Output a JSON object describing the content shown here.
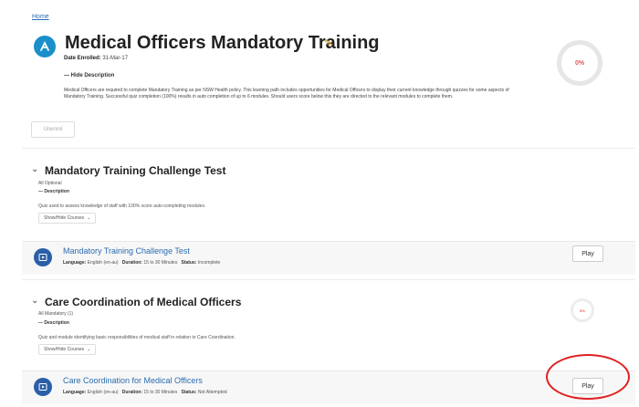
{
  "breadcrumb": {
    "home": "Home"
  },
  "header": {
    "title": "Medical Officers Mandatory Training",
    "date_enrolled_label": "Date Enrolled:",
    "date_enrolled_value": "31-Mar-17",
    "hide_description": "— Hide Description",
    "description": "Medical Officers are required to complete Mandatory Training as per NSW Health policy. This learning path includes opportunities for Medical Officers to display their current knowledge through quizzes for some aspects of Mandatory Training. Successful quiz completion (100%) results in auto completion of up to 6 modules. Should users score below this they are directed to the relevant modules to complete them.",
    "progress": "0%",
    "unenrol_label": "Unenrol"
  },
  "sections": [
    {
      "title": "Mandatory Training Challenge Test",
      "optional_label": "All Optional",
      "description_label": "— Description",
      "description": "Quiz used to assess knowledge of staff with 100% score auto-completing modules.",
      "show_hide_label": "Show/Hide Courses",
      "course": {
        "title": "Mandatory Training Challenge Test",
        "language_label": "Language:",
        "language": "English (en-au)",
        "duration_label": "Duration:",
        "duration": "15 to 30 Minutes",
        "status_label": "Status:",
        "status": "Incomplete",
        "play_label": "Play"
      }
    },
    {
      "title": "Care Coordination of Medical Officers",
      "optional_label": "All Mandatory (1)",
      "description_label": "— Description",
      "description": "Quiz and module identifying basic responsibilities of medical staff in relation to Care Coordination.",
      "show_hide_label": "Show/Hide Courses",
      "progress": "0%",
      "course": {
        "title": "Care Coordination for Medical Officers",
        "language_label": "Language:",
        "language": "English (en-au)",
        "duration_label": "Duration:",
        "duration": "15 to 30 Minutes",
        "status_label": "Status:",
        "status": "Not Attempted",
        "play_label": "Play"
      }
    }
  ],
  "colors": {
    "accent": "#2a6db0",
    "progress_text": "#e05858",
    "annotation": "#e02020",
    "logo": "#1a8fc9"
  },
  "icons": {
    "logo": "learning-path-logo-icon",
    "edit": "pencil-icon",
    "course": "play-circle-icon",
    "chevron": "chevron-down-icon"
  }
}
